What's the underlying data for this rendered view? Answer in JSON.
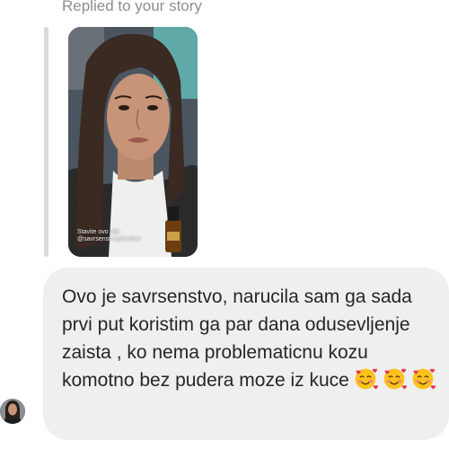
{
  "reply": {
    "label": "Replied to your story"
  },
  "story": {
    "tag_line_1": "Stavite ovo ulje",
    "tag_line_2": "@savrsenstvoprirodno"
  },
  "message": {
    "text": "Ovo je savrsenstvo, narucila sam ga sada prvi put koristim ga par dana odusevljenje zaista , ko nema problematicnu kozu komotno bez pudera moze iz kuce",
    "emojis": [
      "smiling-face-with-hearts",
      "smiling-face-with-hearts",
      "smiling-face-with-hearts"
    ]
  },
  "colors": {
    "bubble": "#efefef",
    "text": "#262626",
    "muted": "#8e8e8e",
    "reply_bar": "#dbdbdb"
  }
}
